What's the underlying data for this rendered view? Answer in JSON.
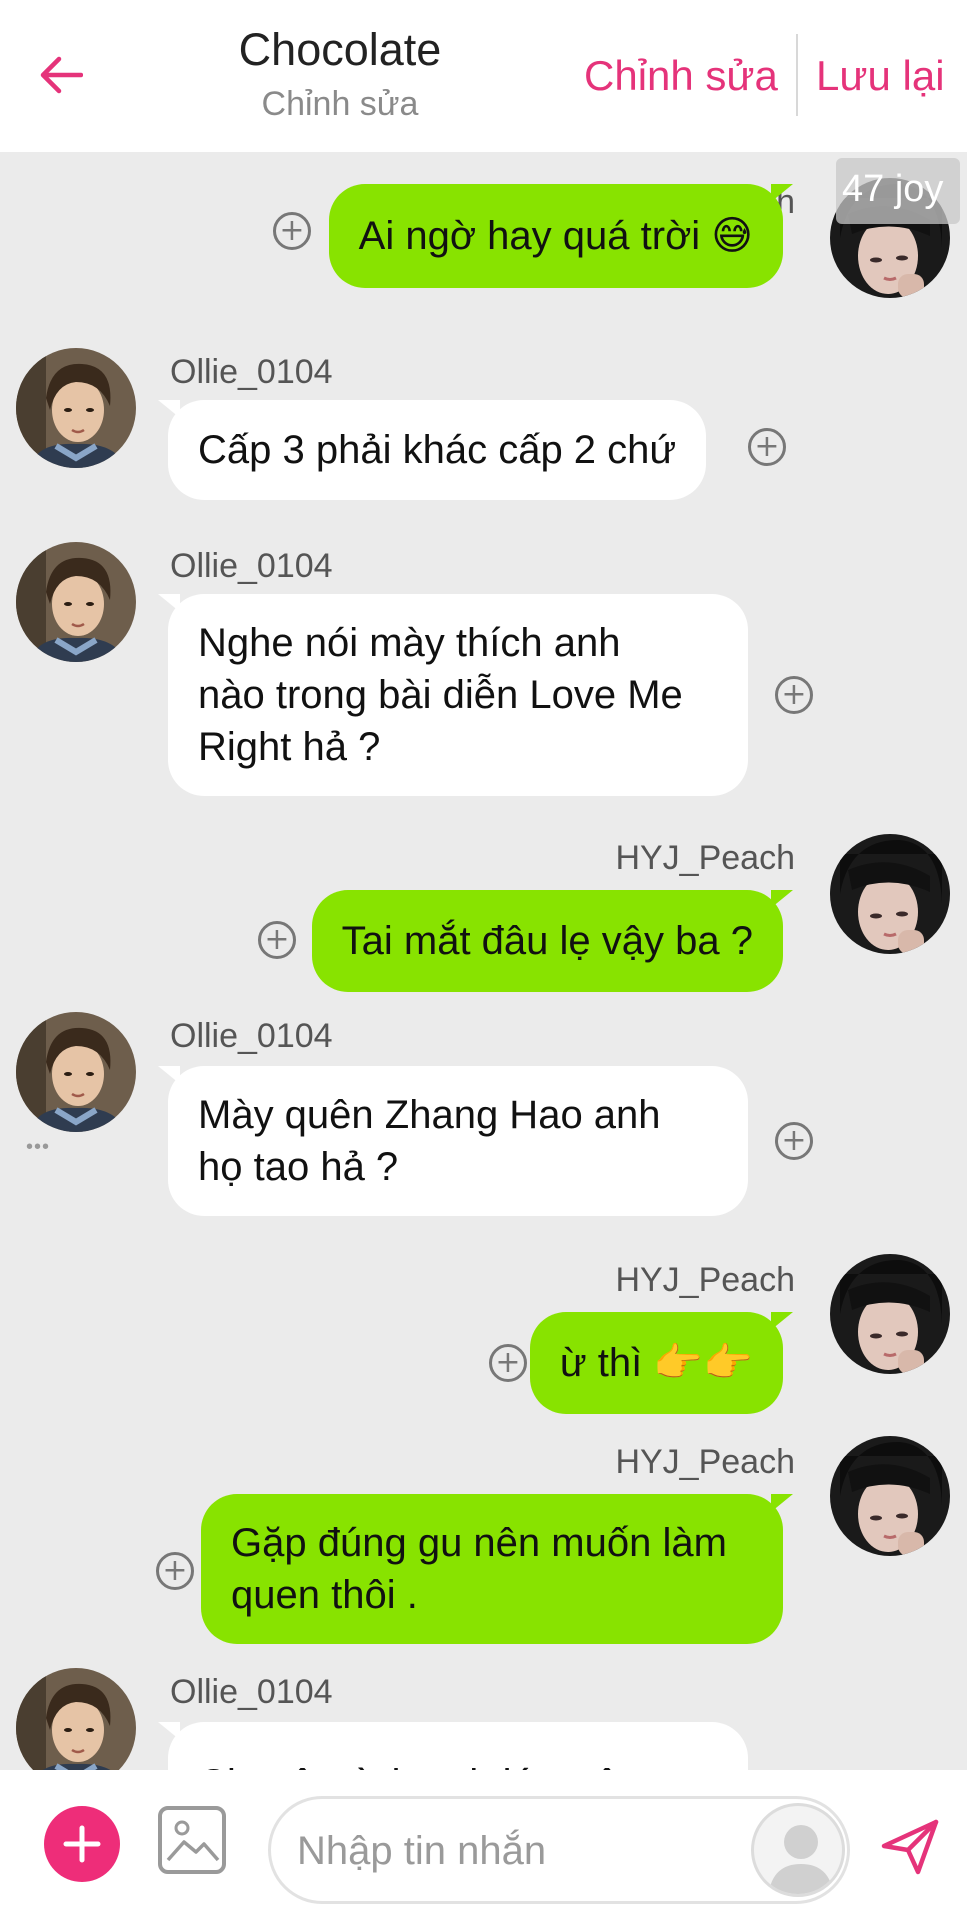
{
  "header": {
    "title": "Chocolate",
    "subtitle": "Chỉnh sửa",
    "edit_label": "Chỉnh sửa",
    "save_label": "Lưu lại",
    "accent_color": "#e5337a"
  },
  "badge": "47 joy",
  "messages": [
    {
      "side": "right",
      "name": "HYJ_Peach",
      "text": "Ai ngờ hay quá trời 😅"
    },
    {
      "side": "left",
      "name": "Ollie_0104",
      "text": "Cấp 3 phải khác cấp 2 chứ"
    },
    {
      "side": "left",
      "name": "Ollie_0104",
      "text": "Nghe nói mày thích anh\nnào trong bài diễn Love Me\nRight hả ?"
    },
    {
      "side": "right",
      "name": "HYJ_Peach",
      "text": "Tai mắt đâu lẹ vậy ba ?"
    },
    {
      "side": "left",
      "name": "Ollie_0104",
      "text": "Mày quên Zhang Hao anh\nhọ tao hả ?"
    },
    {
      "side": "right",
      "name": "HYJ_Peach",
      "text": "ừ thì 👉👉"
    },
    {
      "side": "right",
      "name": "HYJ_Peach",
      "text": "Gặp đúng gu nên muốn làm\nquen thôi ."
    },
    {
      "side": "left",
      "name": "Ollie_0104",
      "text": "Chuyện tình anh lớp trên em"
    }
  ],
  "composer": {
    "placeholder": "Nhập tin nhắn",
    "add_color": "#ee2d79",
    "send_color": "#e5337a"
  },
  "colors": {
    "sent_bubble": "#88e300",
    "received_bubble": "#ffffff",
    "chat_background": "#ebebeb"
  }
}
